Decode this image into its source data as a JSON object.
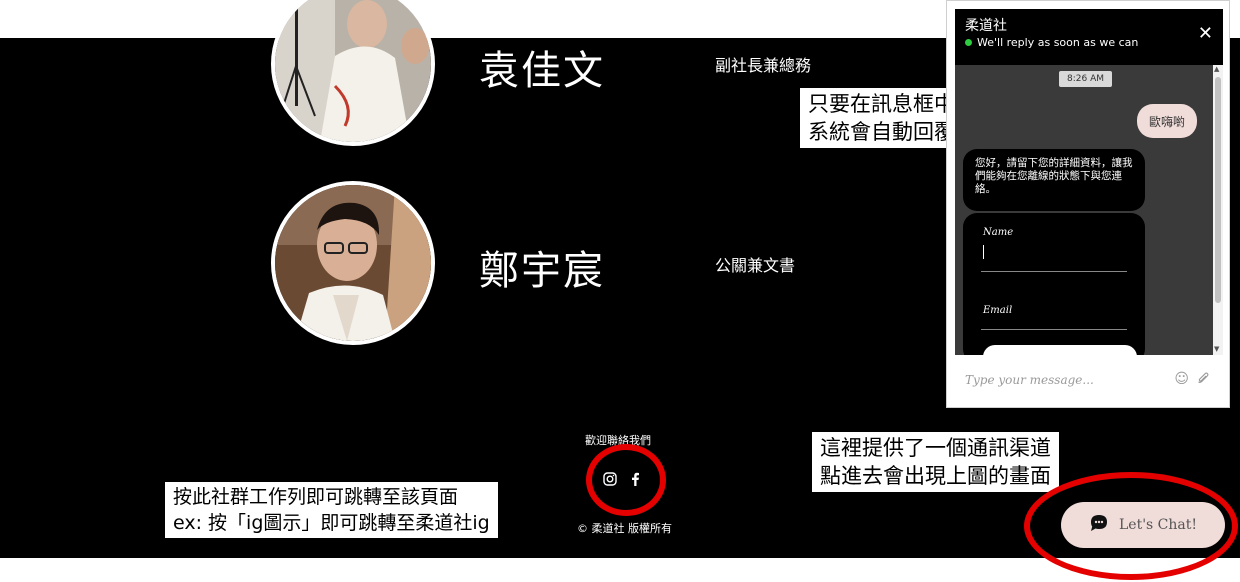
{
  "members": [
    {
      "name": "袁佳文",
      "role": "副社長兼總務"
    },
    {
      "name": "鄭宇宸",
      "role": "公關兼文書"
    }
  ],
  "annotations": {
    "chat_reply": [
      "只要在訊息框中輸入訊息",
      "系統會自動回覆以下內容"
    ],
    "chat_channel": [
      "這裡提供了一個通訊渠道",
      "點進去會出現上圖的畫面"
    ],
    "social_bar": [
      "按此社群工作列即可跳轉至該頁面",
      "ex: 按「ig圖示」即可跳轉至柔道社ig"
    ]
  },
  "footer": {
    "contact_label": "歡迎聯絡我們",
    "copyright": "© 柔道社 版權所有",
    "social": [
      {
        "icon": "instagram-icon"
      },
      {
        "icon": "facebook-icon"
      }
    ]
  },
  "chat": {
    "title": "柔道社",
    "status": "We'll reply as soon as we can",
    "time": "8:26 AM",
    "user_message": "歐嗨喲",
    "bot_message": "您好，請留下您的詳細資料，讓我們能夠在您離線的狀態下與您連絡。",
    "form_fields": [
      "Name",
      "Email"
    ],
    "input_placeholder": "Type your message...",
    "status_color": "#2ecc40"
  },
  "launcher": {
    "label": "Let's Chat!"
  },
  "colors": {
    "highlight": "#e50000",
    "launcher_bg": "#f0dcd9",
    "page_bg": "#000000"
  }
}
